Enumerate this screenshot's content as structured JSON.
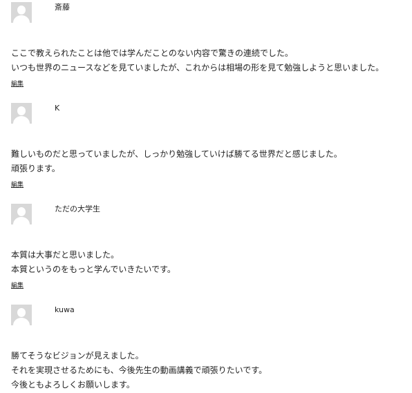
{
  "comments": [
    {
      "author": "斎藤",
      "lines": [
        "ここで教えられたことは他では学んだことのない内容で驚きの連続でした。",
        "いつも世界のニュースなどを見ていましたが、これからは相場の形を見て勉強しようと思いました。"
      ],
      "edit_label": "編集"
    },
    {
      "author": "K",
      "lines": [
        "難しいものだと思っていましたが、しっかり勉強していけば勝てる世界だと感じました。",
        "頑張ります。"
      ],
      "edit_label": "編集"
    },
    {
      "author": "ただの大学生",
      "lines": [
        "本質は大事だと思いました。",
        "本質というのをもっと学んでいきたいです。"
      ],
      "edit_label": "編集"
    },
    {
      "author": "kuwa",
      "lines": [
        "勝てそうなビジョンが見えました。",
        "それを実現させるためにも、今後先生の動画講義で頑張りたいです。",
        "今後ともよろしくお願いします。"
      ]
    }
  ]
}
